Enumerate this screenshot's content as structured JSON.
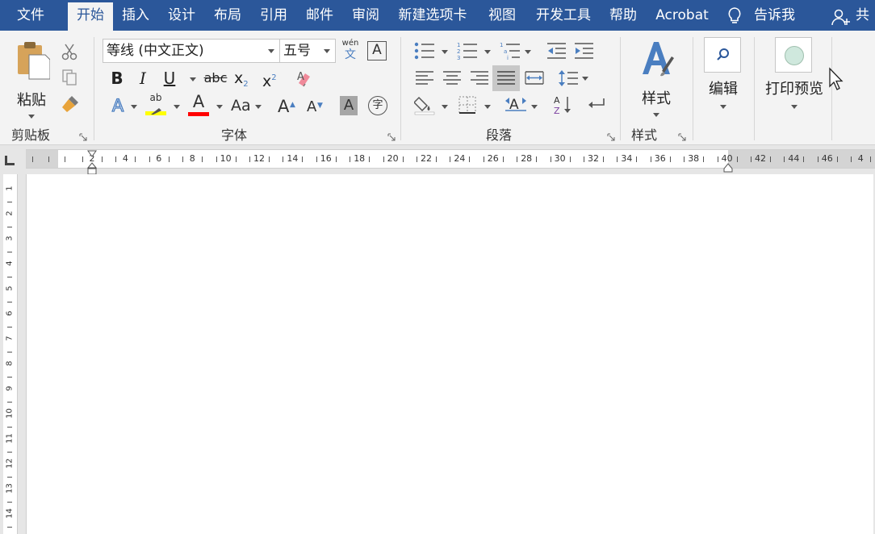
{
  "menu": {
    "tabs": [
      {
        "label": "文件"
      },
      {
        "label": "开始"
      },
      {
        "label": "插入"
      },
      {
        "label": "设计"
      },
      {
        "label": "布局"
      },
      {
        "label": "引用"
      },
      {
        "label": "邮件"
      },
      {
        "label": "审阅"
      },
      {
        "label": "新建选项卡"
      },
      {
        "label": "视图"
      },
      {
        "label": "开发工具"
      },
      {
        "label": "帮助"
      },
      {
        "label": "Acrobat"
      }
    ],
    "active_tab": "开始",
    "tell_me": "告诉我",
    "share": "共"
  },
  "ribbon": {
    "clipboard": {
      "label": "剪贴板",
      "paste": "粘贴",
      "icons": [
        "cut-icon",
        "copy-icon",
        "format-painter-icon"
      ]
    },
    "font": {
      "label": "字体",
      "font_name": "等线 (中文正文)",
      "font_size": "五号",
      "phonetic_top": "wén",
      "phonetic_bottom": "文",
      "border_char": "A",
      "bold": "B",
      "italic": "I",
      "underline": "U",
      "strike": "abc",
      "sub": "x",
      "sub_mark": "2",
      "sup": "x",
      "sup_mark": "2",
      "text_effect": "A",
      "highlight_top": "ab",
      "font_color": "A",
      "change_case": "Aa",
      "grow": "A",
      "shrink": "A",
      "shading": "A",
      "enclose": "字",
      "highlight_color": "#ffff00",
      "font_color_value": "#ff0000"
    },
    "paragraph": {
      "label": "段落"
    },
    "styles": {
      "label": "样式",
      "button": "样式"
    },
    "editing": {
      "button": "编辑"
    },
    "print_preview": {
      "button": "打印预览"
    }
  },
  "ruler": {
    "h_labels": [
      "2",
      "4",
      "6",
      "8",
      "10",
      "12",
      "14",
      "16",
      "18",
      "20",
      "22",
      "24",
      "26",
      "28",
      "30",
      "32",
      "34",
      "36",
      "38",
      "40",
      "42",
      "44",
      "46",
      "4"
    ],
    "v_labels": [
      "1",
      "2",
      "3",
      "4",
      "5",
      "6",
      "7",
      "8",
      "9",
      "10",
      "11",
      "12",
      "13",
      "14"
    ]
  },
  "colors": {
    "title_bar": "#2b579a",
    "ribbon_bg": "#f3f3f3",
    "accent_blue": "#4a7ec0"
  }
}
